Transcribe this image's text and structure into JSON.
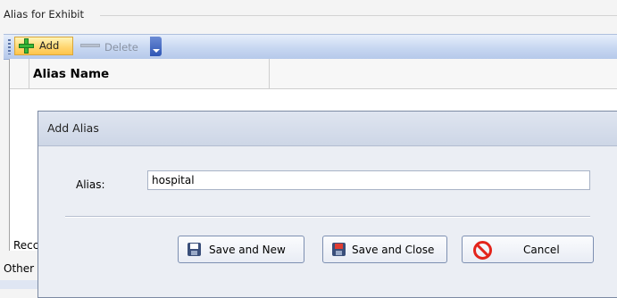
{
  "group": {
    "title": "Alias for Exhibit"
  },
  "toolbar": {
    "add_label": "Add",
    "delete_label": "Delete"
  },
  "grid": {
    "column_header": "Alias Name"
  },
  "footer": {
    "records_label": "Recc",
    "other_label": "Other"
  },
  "dialog": {
    "title": "Add Alias",
    "field_label": "Alias:",
    "alias_value": "hospital",
    "save_new_label": "Save and New",
    "save_close_label": "Save and Close",
    "cancel_label": "Cancel"
  },
  "colors": {
    "toolbar_bg": "#c7d7f1",
    "add_highlight": "#ffd773",
    "cancel_red": "#e3241b"
  }
}
